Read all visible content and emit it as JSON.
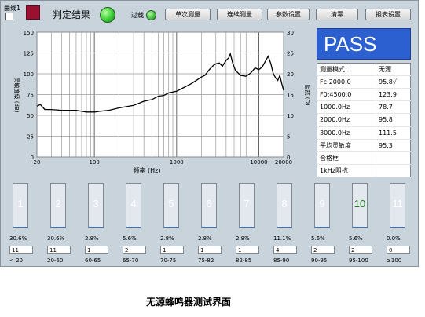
{
  "toolbar": {
    "curve_label": "曲线1",
    "judge_label": "判定结果",
    "overload_label": "过载",
    "buttons": [
      "单次测量",
      "连续测量",
      "参数设置",
      "清零",
      "报表设置"
    ]
  },
  "result": {
    "status": "PASS",
    "color": "#2c5fcf",
    "led_color": "#33cc33"
  },
  "info": [
    {
      "label": "测量模式:",
      "value": "无源"
    },
    {
      "label": "Fc:2000.0",
      "value": "95.8√"
    },
    {
      "label": "F0:4500.0",
      "value": "123.9"
    },
    {
      "label": "1000.0Hz",
      "value": "78.7"
    },
    {
      "label": "2000.0Hz",
      "value": "95.8"
    },
    {
      "label": "3000.0Hz",
      "value": "111.5"
    },
    {
      "label": "平均灵敏度",
      "value": "95.3"
    },
    {
      "label": "合格框",
      "value": ""
    },
    {
      "label": "1kHz阻抗",
      "value": ""
    }
  ],
  "bins": [
    {
      "num": "1",
      "pct": "30.6%",
      "count": "11",
      "range": "< 20"
    },
    {
      "num": "2",
      "pct": "30.6%",
      "count": "11",
      "range": "20-60"
    },
    {
      "num": "3",
      "pct": "2.8%",
      "count": "1",
      "range": "60-65"
    },
    {
      "num": "4",
      "pct": "5.6%",
      "count": "2",
      "range": "65-70"
    },
    {
      "num": "5",
      "pct": "2.8%",
      "count": "1",
      "range": "70-75"
    },
    {
      "num": "6",
      "pct": "2.8%",
      "count": "1",
      "range": "75-82"
    },
    {
      "num": "7",
      "pct": "2.8%",
      "count": "1",
      "range": "82-85"
    },
    {
      "num": "8",
      "pct": "11.1%",
      "count": "4",
      "range": "85-90"
    },
    {
      "num": "9",
      "pct": "5.6%",
      "count": "2",
      "range": "90-95"
    },
    {
      "num": "10",
      "pct": "5.6%",
      "count": "2",
      "range": "95-100"
    },
    {
      "num": "11",
      "pct": "0.0%",
      "count": "0",
      "range": "≥100"
    }
  ],
  "caption": "无源蜂鸣器测试界面",
  "chart_data": {
    "type": "line",
    "xlabel": "频率 (Hz)",
    "ylabel_left": "灵敏度级 (dB)",
    "ylabel_right": "阻抗 (Ω)",
    "x_scale": "log",
    "xlim": [
      20,
      20000
    ],
    "ylim_left": [
      0,
      150
    ],
    "ylim_right": [
      0,
      30
    ],
    "x_ticks": [
      "20",
      "100",
      "1000",
      "10000",
      "20000"
    ],
    "y_ticks_left": [
      "0",
      "25",
      "50",
      "75",
      "100",
      "125",
      "150"
    ],
    "y_ticks_right": [
      "0",
      "5",
      "10",
      "15",
      "20",
      "25",
      "30"
    ],
    "grid": true,
    "series": [
      {
        "color": "#000000",
        "x": [
          20,
          22,
          25,
          30,
          40,
          60,
          80,
          100,
          120,
          150,
          200,
          300,
          400,
          500,
          600,
          700,
          800,
          1000,
          1200,
          1500,
          1800,
          2000,
          2200,
          2500,
          2800,
          3000,
          3300,
          3600,
          4000,
          4300,
          4500,
          4800,
          5200,
          6000,
          7000,
          8000,
          9000,
          10000,
          11000,
          12000,
          13000,
          14000,
          15000,
          16000,
          17000,
          18000,
          19000,
          20000
        ],
        "y": [
          61,
          63,
          57,
          57,
          56,
          56,
          54,
          54,
          55,
          56,
          59,
          62,
          67,
          69,
          73,
          74,
          77,
          79,
          83,
          88,
          93,
          96,
          98,
          105,
          110,
          112,
          113,
          109,
          116,
          119,
          124,
          113,
          104,
          98,
          97,
          101,
          107,
          105,
          108,
          115,
          121,
          112,
          100,
          95,
          92,
          98,
          88,
          80
        ]
      }
    ]
  }
}
